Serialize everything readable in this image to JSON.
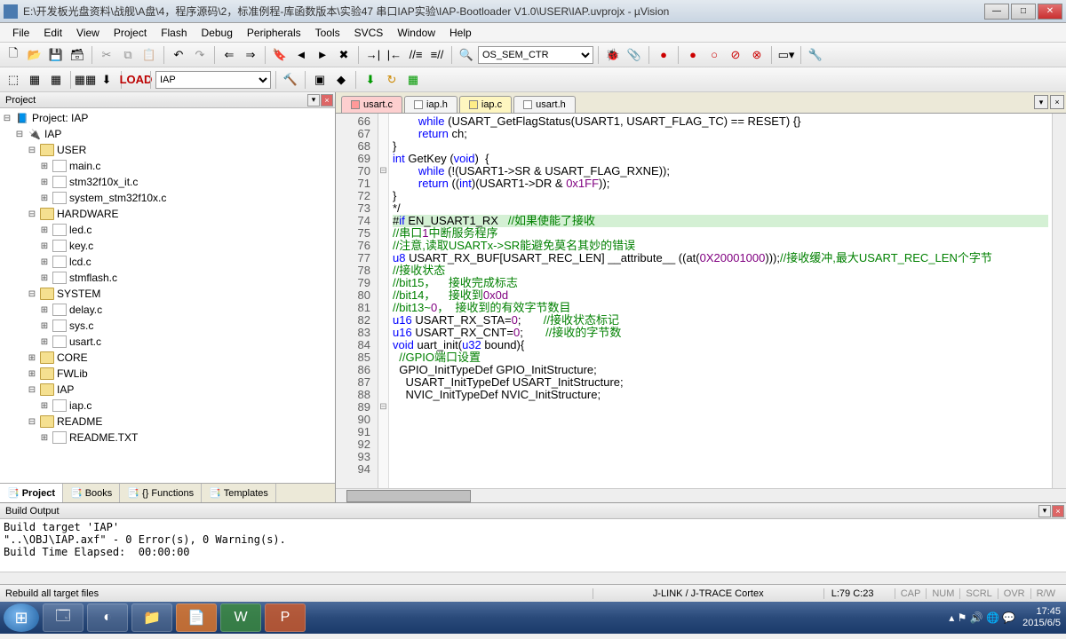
{
  "window": {
    "title": "E:\\开发板光盘资料\\战舰\\A盘\\4，程序源码\\2，标准例程-库函数版本\\实验47 串口IAP实验\\IAP-Bootloader V1.0\\USER\\IAP.uvprojx - µVision"
  },
  "menu": [
    "File",
    "Edit",
    "View",
    "Project",
    "Flash",
    "Debug",
    "Peripherals",
    "Tools",
    "SVCS",
    "Window",
    "Help"
  ],
  "toolbar1": {
    "target_select": "OS_SEM_CTR"
  },
  "toolbar2": {
    "target": "IAP"
  },
  "project_panel": {
    "title": "Project",
    "root": "Project: IAP",
    "target": "IAP",
    "groups": [
      {
        "name": "USER",
        "files": [
          "main.c",
          "stm32f10x_it.c",
          "system_stm32f10x.c"
        ]
      },
      {
        "name": "HARDWARE",
        "files": [
          "led.c",
          "key.c",
          "lcd.c",
          "stmflash.c"
        ]
      },
      {
        "name": "SYSTEM",
        "files": [
          "delay.c",
          "sys.c",
          "usart.c"
        ]
      },
      {
        "name": "CORE",
        "files": []
      },
      {
        "name": "FWLib",
        "files": []
      },
      {
        "name": "IAP",
        "files": [
          "iap.c"
        ]
      },
      {
        "name": "README",
        "files": [
          "README.TXT"
        ]
      }
    ],
    "tabs": [
      "Project",
      "Books",
      "{} Functions",
      "Templates"
    ]
  },
  "editor": {
    "tabs": [
      {
        "name": "usart.c",
        "active": true,
        "color": "active"
      },
      {
        "name": "iap.h",
        "color": ""
      },
      {
        "name": "iap.c",
        "color": "yellow"
      },
      {
        "name": "usart.h",
        "color": ""
      }
    ],
    "first_line": 66,
    "lines": [
      "        while (USART_GetFlagStatus(USART1, USART_FLAG_TC) == RESET) {}",
      "",
      "        return ch;",
      "}",
      "int GetKey (void)  {",
      "",
      "        while (!(USART1->SR & USART_FLAG_RXNE));",
      "",
      "        return ((int)(USART1->DR & 0x1FF));",
      "}",
      "*/",
      "",
      "#if EN_USART1_RX   //如果使能了接收",
      "//串口1中断服务程序",
      "//注意,读取USARTx->SR能避免莫名其妙的错误",
      "u8 USART_RX_BUF[USART_REC_LEN] __attribute__ ((at(0X20001000)));//接收缓冲,最大USART_REC_LEN个字节",
      "//接收状态",
      "//bit15，    接收完成标志",
      "//bit14，    接收到0x0d",
      "//bit13~0，  接收到的有效字节数目",
      "u16 USART_RX_STA=0;       //接收状态标记",
      "u16 USART_RX_CNT=0;       //接收的字节数",
      "",
      "void uart_init(u32 bound){",
      "  //GPIO端口设置",
      "  GPIO_InitTypeDef GPIO_InitStructure;",
      "    USART_InitTypeDef USART_InitStructure;",
      "    NVIC_InitTypeDef NVIC_InitStructure;",
      ""
    ],
    "highlight_index": 12
  },
  "build_output": {
    "title": "Build Output",
    "text": "Build target 'IAP'\n\"..\\OBJ\\IAP.axf\" - 0 Error(s), 0 Warning(s).\nBuild Time Elapsed:  00:00:00"
  },
  "statusbar": {
    "left": "Rebuild all target files",
    "mid": "J-LINK / J-TRACE Cortex",
    "pos": "L:79 C:23",
    "caps": "CAP",
    "num": "NUM",
    "scrl": "SCRL",
    "ovr": "OVR",
    "rw": "R/W"
  },
  "taskbar": {
    "time": "17:45",
    "date": "2015/6/5"
  }
}
